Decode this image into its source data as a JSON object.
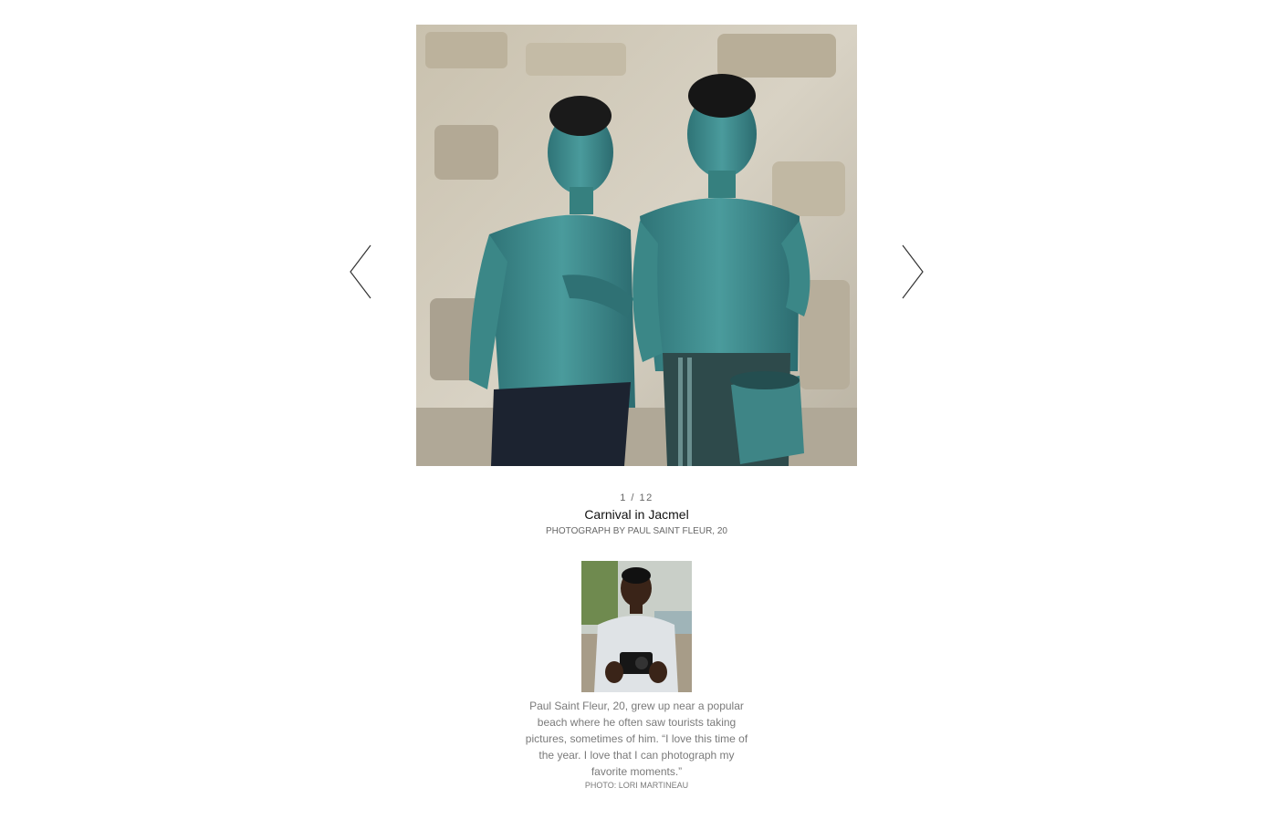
{
  "slideshow": {
    "counter": "1 / 12",
    "title": "Carnival in Jacmel",
    "credit": "PHOTOGRAPH BY PAUL SAINT FLEUR, 20",
    "prev_icon": "chevron-left-icon",
    "next_icon": "chevron-right-icon"
  },
  "photographer": {
    "bio": "Paul Saint Fleur, 20, grew up near a popular beach where he often saw tourists taking pictures, sometimes of him. “I love this time of the year. I love that I can photograph my favorite moments.”",
    "photo_credit": "PHOTO: LORI MARTINEAU"
  },
  "colors": {
    "body_paint": "#3f8a8c",
    "wall": "#cfc7b6",
    "text_muted": "#7a7a7a"
  }
}
